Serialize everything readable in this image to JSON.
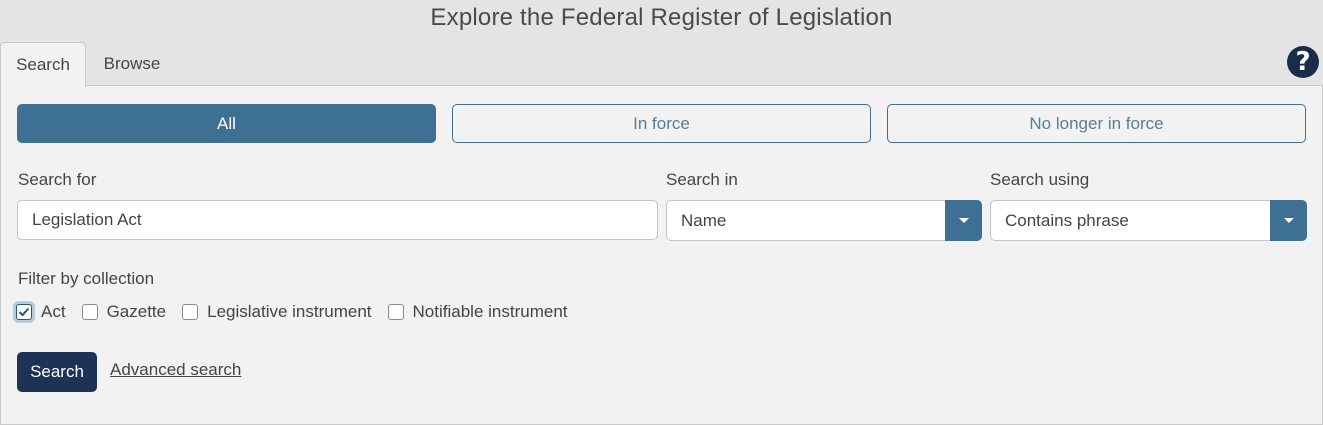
{
  "page": {
    "title": "Explore the Federal Register of Legislation"
  },
  "tabs": [
    {
      "label": "Search",
      "active": true
    },
    {
      "label": "Browse",
      "active": false
    }
  ],
  "help": {
    "icon": "help-icon",
    "glyph": "?"
  },
  "status_filter": [
    {
      "label": "All",
      "selected": true
    },
    {
      "label": "In force",
      "selected": false
    },
    {
      "label": "No longer in force",
      "selected": false
    }
  ],
  "search_for": {
    "label": "Search for",
    "value": "Legislation Act"
  },
  "search_in": {
    "label": "Search in",
    "value": "Name"
  },
  "search_using": {
    "label": "Search using",
    "value": "Contains phrase"
  },
  "collection": {
    "label": "Filter by collection",
    "options": [
      {
        "label": "Act",
        "checked": true
      },
      {
        "label": "Gazette",
        "checked": false
      },
      {
        "label": "Legislative instrument",
        "checked": false
      },
      {
        "label": "Notifiable instrument",
        "checked": false
      }
    ]
  },
  "actions": {
    "search_label": "Search",
    "advanced_label": "Advanced search"
  },
  "colors": {
    "accent": "#3e7093",
    "primary_dark": "#1d3355",
    "panel_bg": "#f2f2f2",
    "page_bg": "#e4e4e5"
  }
}
